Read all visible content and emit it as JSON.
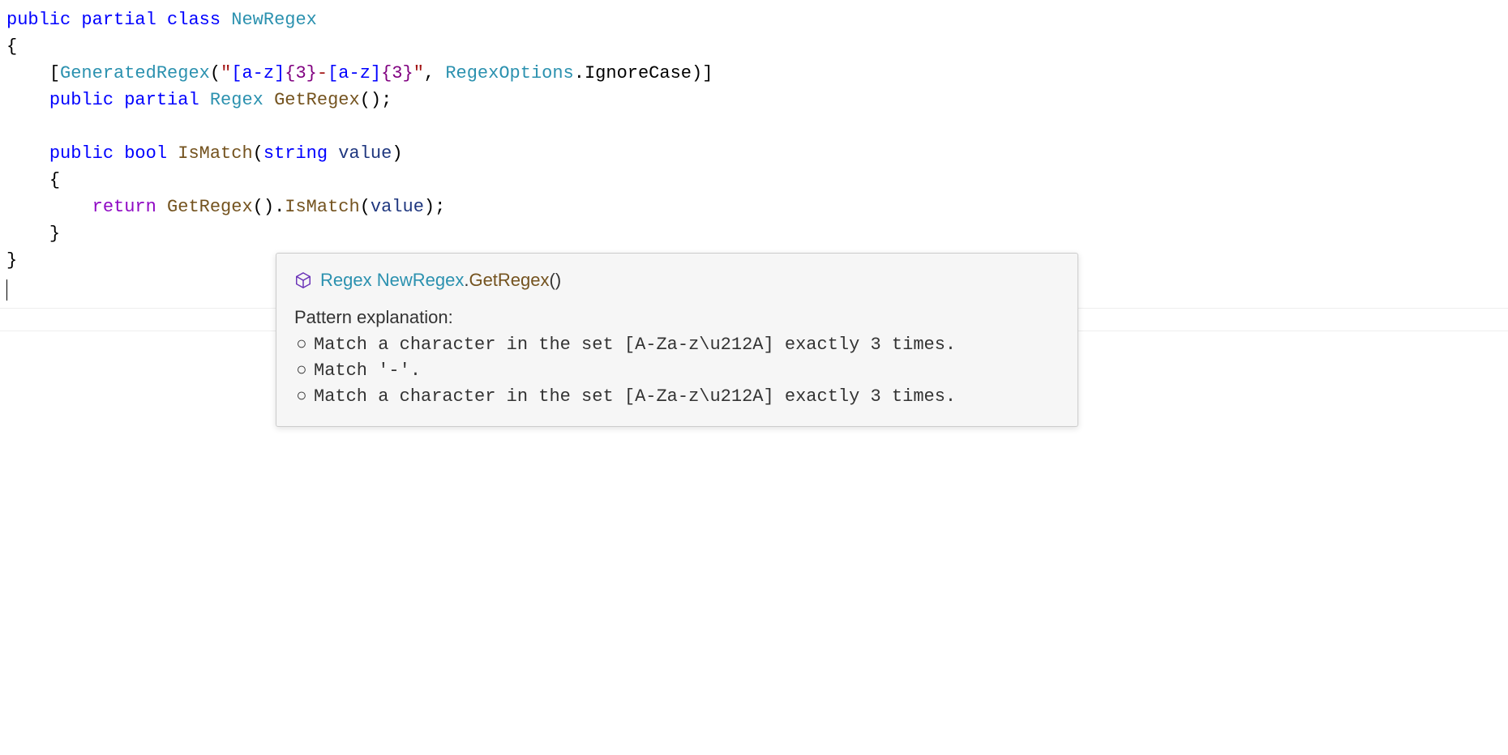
{
  "code": {
    "line1": {
      "kw_public": "public",
      "kw_partial": "partial",
      "kw_class": "class",
      "class_name": "NewRegex"
    },
    "line2": {
      "brace": "{"
    },
    "line3": {
      "indent": "    ",
      "lbracket": "[",
      "attr": "GeneratedRegex",
      "lparen": "(",
      "q1": "\"",
      "s1": "[a-z]",
      "s2": "{3}",
      "s3": "-",
      "s4": "[a-z]",
      "s5": "{3}",
      "q2": "\"",
      "comma": ", ",
      "enum_type": "RegexOptions",
      "dot": ".",
      "enum_member": "IgnoreCase",
      "rparen": ")",
      "rbracket": "]"
    },
    "line4": {
      "indent": "    ",
      "kw_public": "public",
      "kw_partial": "partial",
      "ret_type": "Regex",
      "method": "GetRegex",
      "parens_semi": "();"
    },
    "line5": {
      "blank": " "
    },
    "line6": {
      "indent": "    ",
      "kw_public": "public",
      "kw_bool": "bool",
      "method": "IsMatch",
      "lparen": "(",
      "param_type": "string",
      "param_name": "value",
      "rparen": ")"
    },
    "line7": {
      "indent": "    ",
      "brace": "{"
    },
    "line8": {
      "indent": "        ",
      "kw_return": "return",
      "call1": "GetRegex",
      "call1_parens": "()",
      "dot": ".",
      "call2": "IsMatch",
      "lparen": "(",
      "arg": "value",
      "rparen_semi": ");"
    },
    "line9": {
      "indent": "    ",
      "brace": "}"
    },
    "line10": {
      "brace": "}"
    }
  },
  "tooltip": {
    "icon_name": "class-cube-icon",
    "sig": {
      "ret_type": "Regex",
      "space": " ",
      "class_name": "NewRegex",
      "dot": ".",
      "method": "GetRegex",
      "parens": "()"
    },
    "explain_label": "Pattern explanation:",
    "bullets": [
      "Match a character in the set [A-Za-z\\u212A] exactly 3 times.",
      "Match '-'.",
      "Match a character in the set [A-Za-z\\u212A] exactly 3 times."
    ],
    "bullet_glyph": "○"
  }
}
